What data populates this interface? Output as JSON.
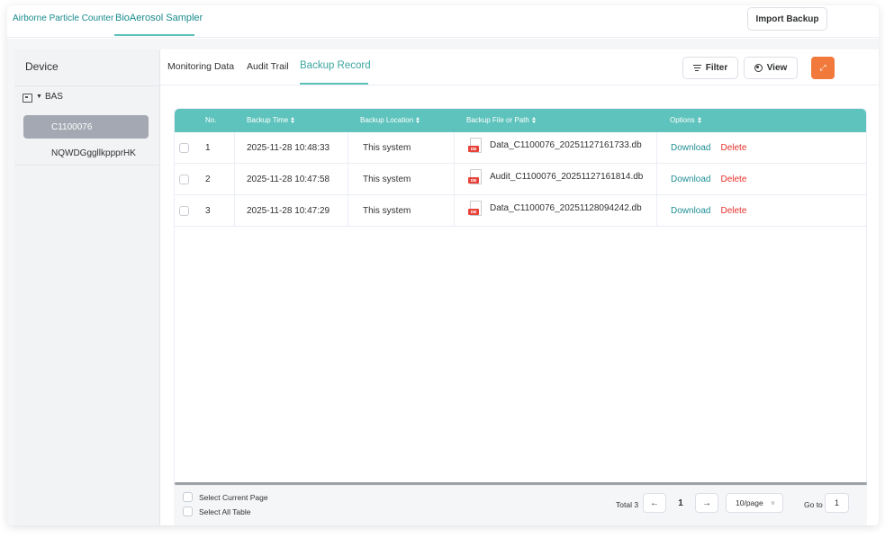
{
  "top_tabs": [
    {
      "label": "Airborne Particle Counter"
    },
    {
      "label": "BioAerosol Sampler",
      "active": true
    }
  ],
  "import_button": "Import Backup",
  "sidebar": {
    "title": "Device",
    "root": "BAS",
    "items": [
      {
        "label": "C1100076",
        "selected": true
      },
      {
        "label": "NQWDGggllkppprHK",
        "selected": false
      }
    ]
  },
  "main_tabs": [
    {
      "label": "Monitoring Data"
    },
    {
      "label": "Audit Trail"
    },
    {
      "label": "Backup Record",
      "active": true
    }
  ],
  "toolbar": {
    "filter": "Filter",
    "view": "View"
  },
  "table": {
    "columns": [
      "No.",
      "Backup Time",
      "Backup Location",
      "Backup File or Path",
      "Options"
    ],
    "rows": [
      {
        "no": "1",
        "time": "2025-11-28 10:48:33",
        "location": "This system",
        "file": "Data_C1100076_20251127161733.db"
      },
      {
        "no": "2",
        "time": "2025-11-28 10:47:58",
        "location": "This system",
        "file": "Audit_C1100076_20251127161814.db"
      },
      {
        "no": "3",
        "time": "2025-11-28 10:47:29",
        "location": "This system",
        "file": "Data_C1100076_20251128094242.db"
      }
    ],
    "actions": {
      "download": "Download",
      "delete": "Delete"
    },
    "file_badge": "DB"
  },
  "footer": {
    "select_current": "Select Current Page",
    "select_all": "Select All Table",
    "total": "Total 3",
    "current_page": "1",
    "page_size": "10/page",
    "goto_label": "Go to",
    "goto_value": "1"
  },
  "colors": {
    "accent": "#5fc3bd",
    "brand_orange": "#f2793c",
    "delete": "#e5302b",
    "link": "#1f8f95"
  }
}
